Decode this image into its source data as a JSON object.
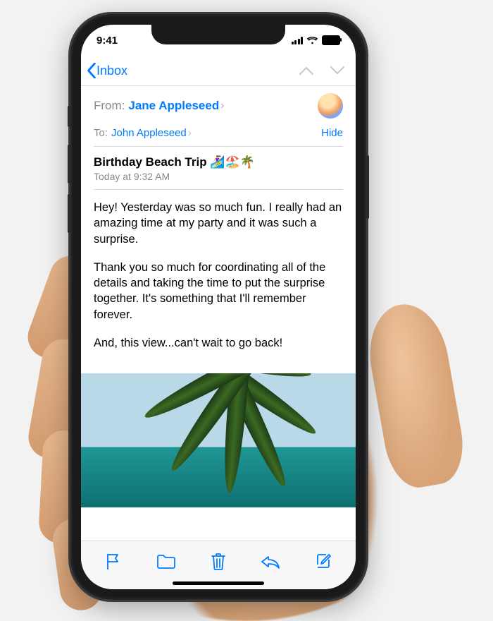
{
  "status": {
    "time": "9:41"
  },
  "nav": {
    "back_label": "Inbox"
  },
  "header": {
    "from_label": "From:",
    "from_name": "Jane Appleseed",
    "to_label": "To:",
    "to_name": "John Appleseed",
    "hide_label": "Hide"
  },
  "message": {
    "subject": "Birthday Beach Trip 🏄‍♀️🏖️🌴",
    "datetime": "Today at 9:32 AM",
    "paragraphs": {
      "p1": "Hey! Yesterday was so much fun. I really had an amazing time at my party and it was such a surprise.",
      "p2": "Thank you so much for coordinating all of the details and taking the time to put the surprise together. It's something that I'll remember forever.",
      "p3": "And, this view...can't wait to go back!"
    },
    "attachment_alt": "palm-tree-beach-photo"
  },
  "toolbar": {
    "flag": "flag",
    "move": "move-to-folder",
    "trash": "trash",
    "reply": "reply",
    "compose": "compose"
  },
  "colors": {
    "accent": "#007aff"
  }
}
